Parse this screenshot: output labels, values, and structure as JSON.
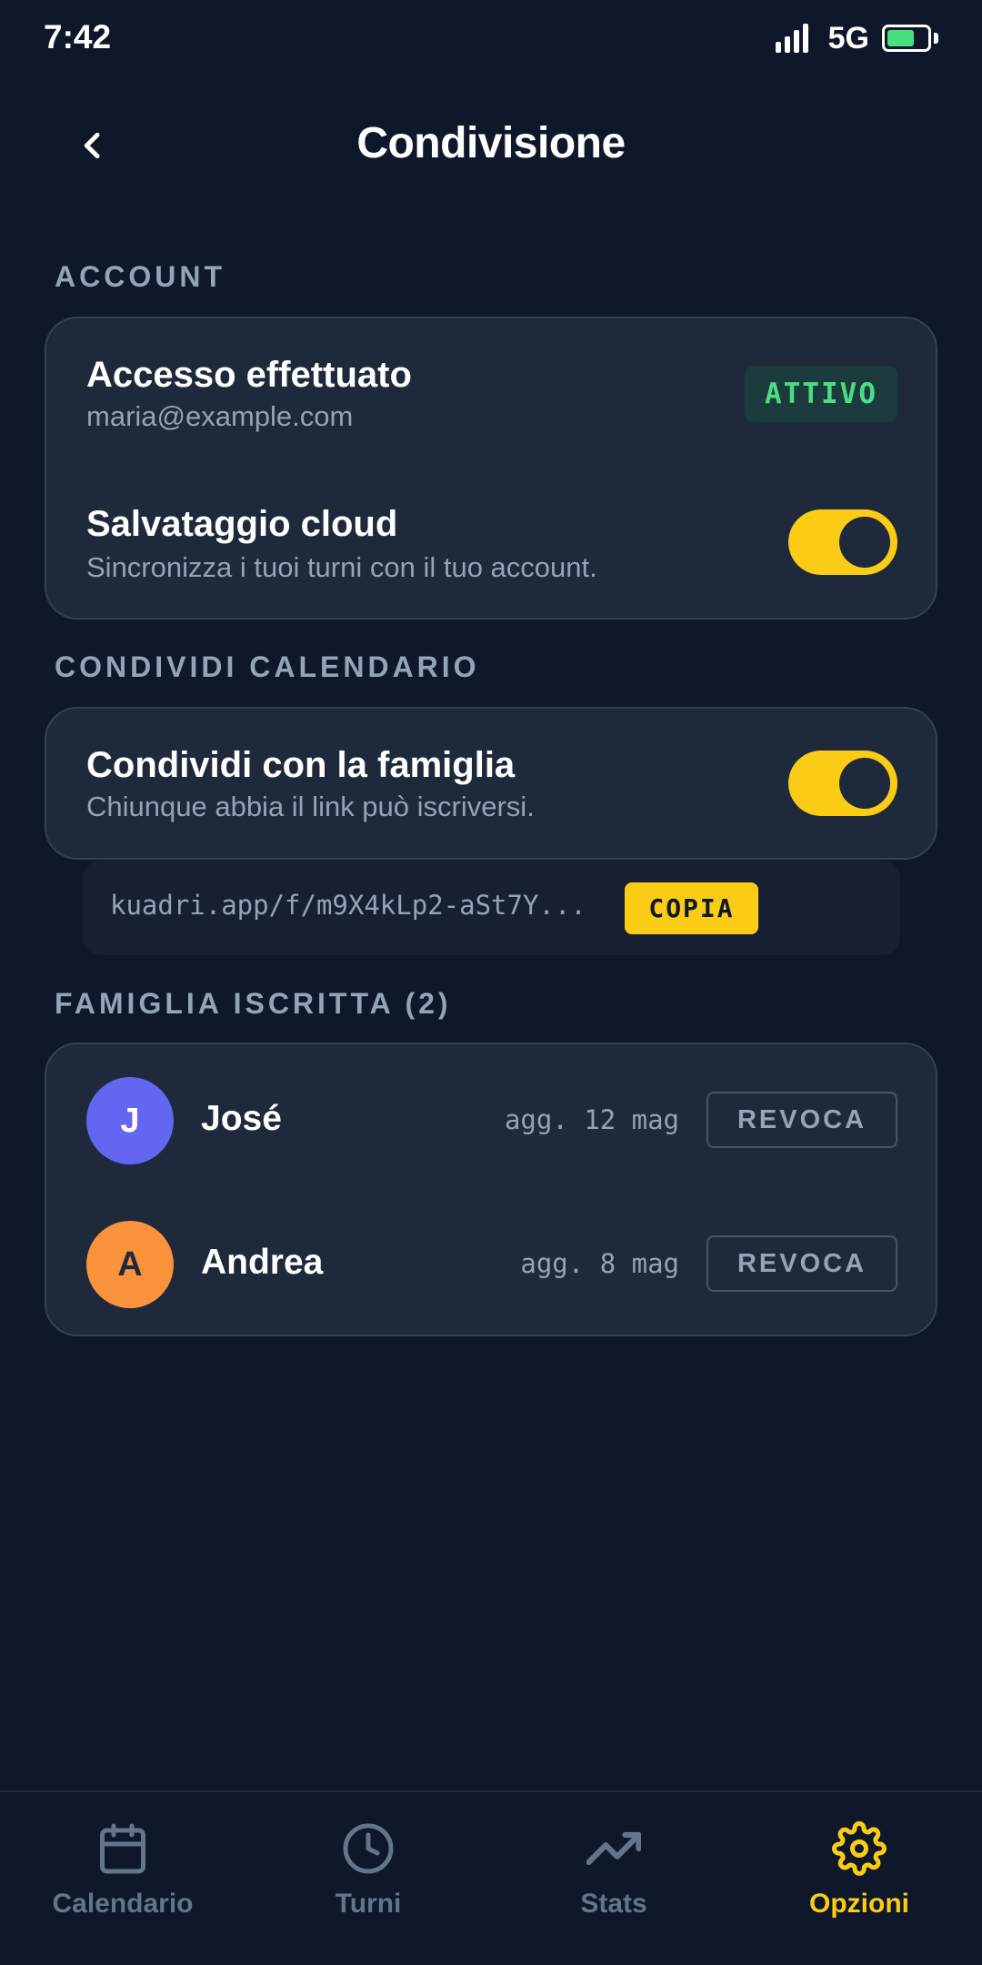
{
  "status_bar": {
    "time": "7:42",
    "network": "5G",
    "battery_level": 0.7,
    "battery_color": "#4ade80"
  },
  "header": {
    "title": "Condivisione",
    "back_icon": "chevron-left-icon"
  },
  "account": {
    "section_label": "ACCOUNT",
    "login_title": "Accesso effettuato",
    "email": "maria@example.com",
    "status_badge": "ATTIVO",
    "cloud_title": "Salvataggio cloud",
    "cloud_subtitle": "Sincronizza i tuoi turni con il tuo account.",
    "cloud_enabled": true
  },
  "share": {
    "section_label": "CONDIVIDI CALENDARIO",
    "family_title": "Condividi con la famiglia",
    "family_subtitle": "Chiunque abbia il link può iscriversi.",
    "family_enabled": true,
    "link": "kuadri.app/f/m9X4kLp2-aSt7Y...",
    "copy_label": "COPIA"
  },
  "family": {
    "section_label": "FAMIGLIA ISCRITTA (2)",
    "members": [
      {
        "initial": "J",
        "name": "José",
        "updated": "agg. 12 mag",
        "revoke_label": "REVOCA",
        "avatar_color": "#6366f1",
        "initial_color": "#ffffff"
      },
      {
        "initial": "A",
        "name": "Andrea",
        "updated": "agg. 8 mag",
        "revoke_label": "REVOCA",
        "avatar_color": "#fb923c",
        "initial_color": "#1e293b"
      }
    ]
  },
  "nav": {
    "items": [
      {
        "label": "Calendario",
        "icon": "calendar-icon",
        "active": false
      },
      {
        "label": "Turni",
        "icon": "clock-icon",
        "active": false
      },
      {
        "label": "Stats",
        "icon": "trending-up-icon",
        "active": false
      },
      {
        "label": "Opzioni",
        "icon": "gear-icon",
        "active": true
      }
    ]
  },
  "colors": {
    "background": "#0f172a",
    "card": "#1e293b",
    "accent": "#facc15",
    "muted": "#94a3b8",
    "success": "#4ade80"
  }
}
